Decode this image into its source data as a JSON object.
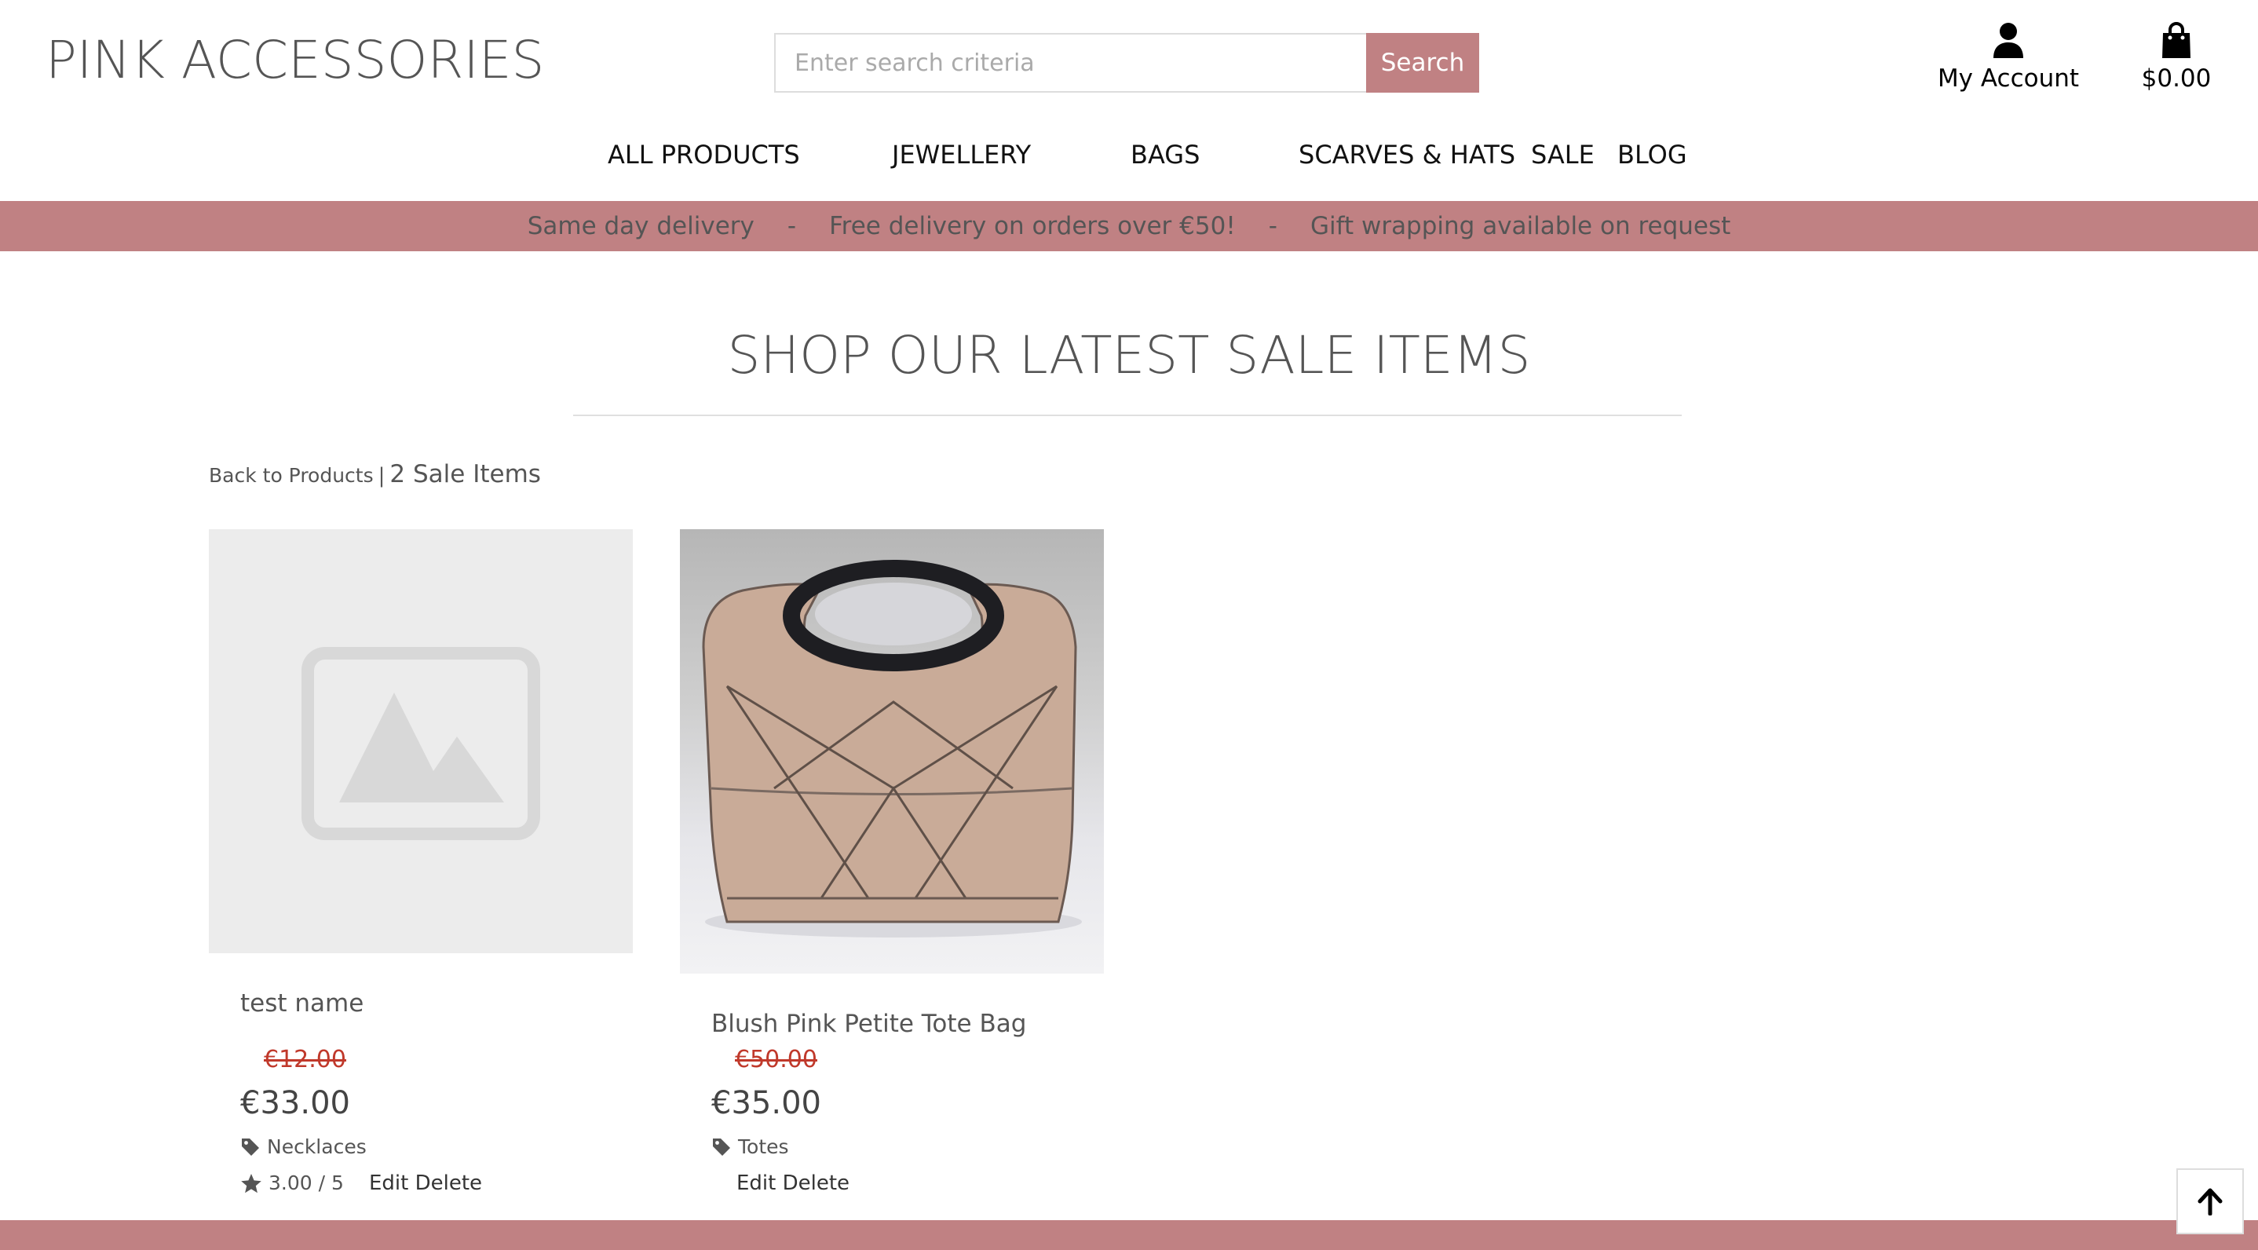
{
  "header": {
    "logo": "PINK ACCESSORIES",
    "search_placeholder": "Enter search criteria",
    "search_button": "Search",
    "account_label": "My Account",
    "cart_total": "$0.00"
  },
  "nav": {
    "items": [
      "ALL PRODUCTS",
      "JEWELLERY",
      "BAGS",
      "SCARVES & HATS",
      "SALE",
      "BLOG"
    ]
  },
  "banner": {
    "messages": [
      "Same day delivery",
      "Free delivery on orders over €50!",
      "Gift wrapping available on request"
    ],
    "separator": "-"
  },
  "main": {
    "heading": "SHOP OUR LATEST SALE ITEMS",
    "back_link": "Back to Products",
    "divider": "|",
    "count_label": "2 Sale Items"
  },
  "products": [
    {
      "name": "test name",
      "old_price": "€12.00",
      "price": "€33.00",
      "category": "Necklaces",
      "rating": "3.00 / 5",
      "edit_label": "Edit",
      "delete_label": "Delete"
    },
    {
      "name": "Blush Pink Petite Tote Bag",
      "old_price": "€50.00",
      "price": "€35.00",
      "category": "Totes",
      "edit_label": "Edit",
      "delete_label": "Delete"
    }
  ],
  "colors": {
    "accent": "#c08183",
    "sale_red": "#c0392b",
    "text": "#555555"
  },
  "icons": [
    "user-icon",
    "shopping-bag-icon",
    "tag-icon",
    "star-icon",
    "image-placeholder-icon",
    "arrow-up-icon"
  ]
}
